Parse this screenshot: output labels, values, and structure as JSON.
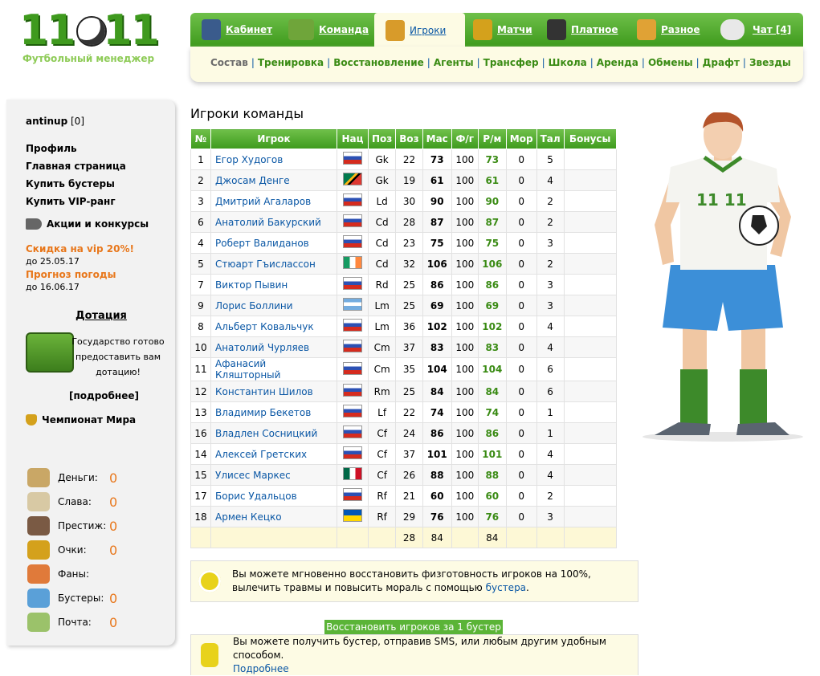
{
  "logo": {
    "number": "11",
    "number2": "11",
    "subtitle": "Футбольный менеджер"
  },
  "top_nav": [
    {
      "label": "Кабинет",
      "color": "#3a5b8c"
    },
    {
      "label": "Команда",
      "color": "#6fa53a"
    },
    {
      "label": "Игроки",
      "color": "#d89b2a",
      "active": true
    },
    {
      "label": "Матчи",
      "color": "#d4a11c"
    },
    {
      "label": "Платное",
      "color": "#333333"
    },
    {
      "label": "Разное",
      "color": "#e0a235"
    },
    {
      "label": "Чат [4]",
      "color": "#e8e8e8"
    }
  ],
  "sub_nav": [
    "Состав",
    "Тренировка",
    "Восстановление",
    "Агенты",
    "Трансфер",
    "Школа",
    "Аренда",
    "Обмены",
    "Драфт",
    "Звезды"
  ],
  "sidebar": {
    "username": "antinup",
    "user_count": "[0]",
    "links": [
      "Профиль",
      "Главная страница",
      "Купить бустеры",
      "Купить VIP-ранг"
    ],
    "promo": "Акции и конкурсы",
    "offers": [
      {
        "label": "Скидка на vip 20%!",
        "until": "до 25.05.17"
      },
      {
        "label": "Прогноз погоды",
        "until": "до 16.06.17"
      }
    ],
    "dotation_title": "Дотация",
    "dotation_text": "Государство готово предоставить вам дотацию!",
    "dotation_more": "[подробнее]",
    "world_cup": "Чемпионат Мира",
    "stats": [
      {
        "label": "Деньги:",
        "value": "0",
        "icon": "money-bag-icon"
      },
      {
        "label": "Слава:",
        "value": "0",
        "icon": "podium-icon"
      },
      {
        "label": "Престиж:",
        "value": "0",
        "icon": "person-icon"
      },
      {
        "label": "Очки:",
        "value": "0",
        "icon": "trophy-icon"
      },
      {
        "label": "Фаны:",
        "value": "",
        "icon": "fans-icon"
      },
      {
        "label": "Бустеры:",
        "value": "0",
        "icon": "gift-icon"
      },
      {
        "label": "Почта:",
        "value": "0",
        "icon": "envelope-icon"
      }
    ]
  },
  "page_title": "Игроки команды",
  "table": {
    "headers": [
      "№",
      "Игрок",
      "Нац",
      "Поз",
      "Воз",
      "Мас",
      "Ф/г",
      "Р/м",
      "Мор",
      "Тал",
      "Бонусы"
    ],
    "rows": [
      {
        "num": "1",
        "name": "Егор Худогов",
        "flag": "ru",
        "pos": "Gk",
        "age": "22",
        "mas": "73",
        "fg": "100",
        "rm": "73",
        "mor": "0",
        "tal": "5"
      },
      {
        "num": "2",
        "name": "Джосам Денге",
        "flag": "za",
        "pos": "Gk",
        "age": "19",
        "mas": "61",
        "fg": "100",
        "rm": "61",
        "mor": "0",
        "tal": "4"
      },
      {
        "num": "3",
        "name": "Дмитрий Агаларов",
        "flag": "ru",
        "pos": "Ld",
        "age": "30",
        "mas": "90",
        "fg": "100",
        "rm": "90",
        "mor": "0",
        "tal": "2"
      },
      {
        "num": "6",
        "name": "Анатолий Бакурский",
        "flag": "ru",
        "pos": "Cd",
        "age": "28",
        "mas": "87",
        "fg": "100",
        "rm": "87",
        "mor": "0",
        "tal": "2"
      },
      {
        "num": "4",
        "name": "Роберт Валиданов",
        "flag": "ru",
        "pos": "Cd",
        "age": "23",
        "mas": "75",
        "fg": "100",
        "rm": "75",
        "mor": "0",
        "tal": "3"
      },
      {
        "num": "5",
        "name": "Стюарт Гъислассон",
        "flag": "ie",
        "pos": "Cd",
        "age": "32",
        "mas": "106",
        "fg": "100",
        "rm": "106",
        "mor": "0",
        "tal": "2"
      },
      {
        "num": "7",
        "name": "Виктор Пывин",
        "flag": "ru",
        "pos": "Rd",
        "age": "25",
        "mas": "86",
        "fg": "100",
        "rm": "86",
        "mor": "0",
        "tal": "3"
      },
      {
        "num": "9",
        "name": "Лорис Боллини",
        "flag": "ar",
        "pos": "Lm",
        "age": "25",
        "mas": "69",
        "fg": "100",
        "rm": "69",
        "mor": "0",
        "tal": "3"
      },
      {
        "num": "8",
        "name": "Альберт Ковальчук",
        "flag": "ru",
        "pos": "Lm",
        "age": "36",
        "mas": "102",
        "fg": "100",
        "rm": "102",
        "mor": "0",
        "tal": "4"
      },
      {
        "num": "10",
        "name": "Анатолий Чурляев",
        "flag": "ru",
        "pos": "Cm",
        "age": "37",
        "mas": "83",
        "fg": "100",
        "rm": "83",
        "mor": "0",
        "tal": "4"
      },
      {
        "num": "11",
        "name": "Афанасий Кляшторный",
        "flag": "ru",
        "pos": "Cm",
        "age": "35",
        "mas": "104",
        "fg": "100",
        "rm": "104",
        "mor": "0",
        "tal": "6"
      },
      {
        "num": "12",
        "name": "Константин Шилов",
        "flag": "ru",
        "pos": "Rm",
        "age": "25",
        "mas": "84",
        "fg": "100",
        "rm": "84",
        "mor": "0",
        "tal": "6"
      },
      {
        "num": "13",
        "name": "Владимир Бекетов",
        "flag": "ru",
        "pos": "Lf",
        "age": "22",
        "mas": "74",
        "fg": "100",
        "rm": "74",
        "mor": "0",
        "tal": "1"
      },
      {
        "num": "16",
        "name": "Владлен Сосницкий",
        "flag": "ru",
        "pos": "Cf",
        "age": "24",
        "mas": "86",
        "fg": "100",
        "rm": "86",
        "mor": "0",
        "tal": "1"
      },
      {
        "num": "14",
        "name": "Алексей Гретских",
        "flag": "ru",
        "pos": "Cf",
        "age": "37",
        "mas": "101",
        "fg": "100",
        "rm": "101",
        "mor": "0",
        "tal": "4"
      },
      {
        "num": "15",
        "name": "Улисес Маркес",
        "flag": "mx",
        "pos": "Cf",
        "age": "26",
        "mas": "88",
        "fg": "100",
        "rm": "88",
        "mor": "0",
        "tal": "4"
      },
      {
        "num": "17",
        "name": "Борис Удальцов",
        "flag": "ru",
        "pos": "Rf",
        "age": "21",
        "mas": "60",
        "fg": "100",
        "rm": "60",
        "mor": "0",
        "tal": "2"
      },
      {
        "num": "18",
        "name": "Армен Кецко",
        "flag": "ua",
        "pos": "Rf",
        "age": "29",
        "mas": "76",
        "fg": "100",
        "rm": "76",
        "mor": "0",
        "tal": "3"
      }
    ],
    "totals": {
      "age": "28",
      "mas": "84",
      "rm": "84"
    }
  },
  "info_restore": {
    "text": "Вы можете мгновенно восстановить физготовность игроков на 100%, вылечить травмы и повысить мораль с помощью",
    "link": "бустера",
    "tail": "."
  },
  "restore_button": "Восстановить игроков за 1 бустер",
  "info_sms": {
    "text": "Вы можете получить бустер, отправив SMS, или любым другим удобным способом.",
    "link": "Подробнее"
  },
  "colors": {
    "green": "#3e9a1c",
    "orange": "#e8771b",
    "link": "#0a57a5",
    "cream": "#fdfbe4"
  }
}
